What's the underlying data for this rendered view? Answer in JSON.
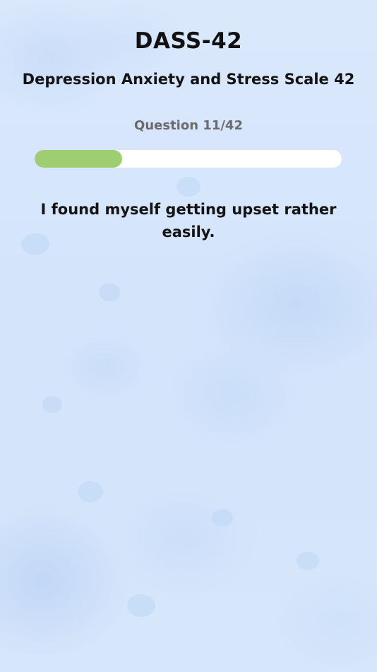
{
  "header": {
    "title": "DASS-42",
    "subtitle": "Depression Anxiety and Stress Scale 42"
  },
  "progress": {
    "counter_text": "Question 11/42",
    "current": 11,
    "total": 42,
    "fraction": 0.2857,
    "fill_color": "#9fcd72",
    "track_color": "#ffffff"
  },
  "question": {
    "text": "I found myself getting upset rather easily."
  },
  "theme": {
    "background": "#d6e6fb"
  }
}
